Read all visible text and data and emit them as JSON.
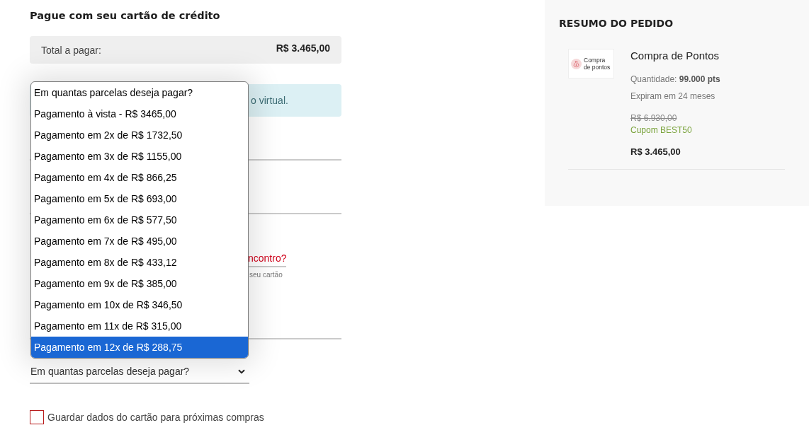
{
  "payment": {
    "title": "Pague com seu cartão de crédito",
    "total": {
      "label": "Total a pagar:",
      "value": "R$ 3.465,00"
    },
    "info_notice": "o virtual.",
    "fields": [
      {
        "kind": "input"
      },
      {
        "kind": "input"
      }
    ],
    "link": "ncontro?",
    "hint": "seu cartão",
    "field_after_hint": {
      "kind": "input"
    },
    "installments_select": {
      "value": "Em quantas parcelas deseja pagar?"
    },
    "installment_options": [
      {
        "label": "Em quantas parcelas deseja pagar?",
        "selected": false
      },
      {
        "label": "Pagamento à vista - R$ 3465,00",
        "selected": false
      },
      {
        "label": "Pagamento em 2x de R$ 1732,50",
        "selected": false
      },
      {
        "label": "Pagamento em 3x de R$ 1155,00",
        "selected": false
      },
      {
        "label": "Pagamento em 4x de R$ 866,25",
        "selected": false
      },
      {
        "label": "Pagamento em 5x de R$ 693,00",
        "selected": false
      },
      {
        "label": "Pagamento em 6x de R$ 577,50",
        "selected": false
      },
      {
        "label": "Pagamento em 7x de R$ 495,00",
        "selected": false
      },
      {
        "label": "Pagamento em 8x de R$ 433,12",
        "selected": false
      },
      {
        "label": "Pagamento em 9x de R$ 385,00",
        "selected": false
      },
      {
        "label": "Pagamento em 10x de R$ 346,50",
        "selected": false
      },
      {
        "label": "Pagamento em 11x de R$ 315,00",
        "selected": false
      },
      {
        "label": "Pagamento em 12x de R$ 288,75",
        "selected": true
      }
    ],
    "save_card": {
      "label": "Guardar dados do cartão para próximas compras",
      "checked": false
    }
  },
  "order_summary": {
    "title": "RESUMO DO PEDIDO",
    "item": {
      "thumbnail_text": "Compra de pontos",
      "name": "Compra de Pontos",
      "quantity": "Quantidade: **99.000 pts**",
      "expiry": "Expiram em 24 meses",
      "old_price": "R$ 6.930,00",
      "coupon": "Cupom BEST50",
      "price": "R$ 3.465,00"
    }
  }
}
